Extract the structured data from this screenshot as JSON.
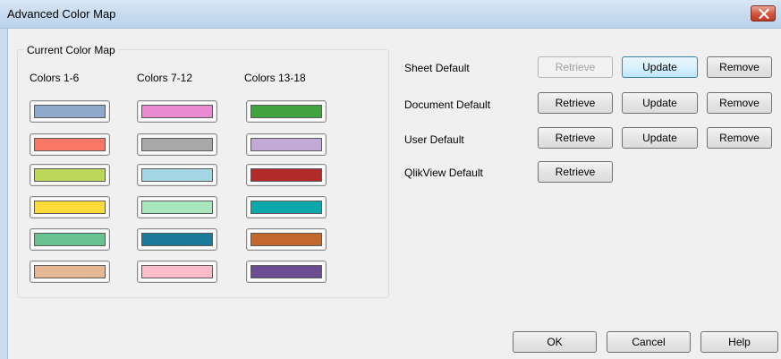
{
  "window": {
    "title": "Advanced Color Map",
    "close_icon": "close-icon"
  },
  "color_map": {
    "group_title": "Current Color Map",
    "columns": [
      {
        "header": "Colors 1-6",
        "colors": [
          "#8fa9cb",
          "#fb7766",
          "#bcd85a",
          "#ffdb3a",
          "#6ac292",
          "#e6b795"
        ]
      },
      {
        "header": "Colors 7-12",
        "colors": [
          "#ea8bd2",
          "#a8a8a8",
          "#a5d6e6",
          "#a9e5bd",
          "#1c7a98",
          "#fcbcc9"
        ]
      },
      {
        "header": "Colors 13-18",
        "colors": [
          "#41a33e",
          "#c1aad6",
          "#b22a2a",
          "#0aa8a8",
          "#c2682f",
          "#6a4e91"
        ]
      }
    ]
  },
  "defaults": {
    "rows": [
      {
        "label": "Sheet Default",
        "retrieve": "Retrieve",
        "update": "Update",
        "remove": "Remove"
      },
      {
        "label": "Document Default",
        "retrieve": "Retrieve",
        "update": "Update",
        "remove": "Remove"
      },
      {
        "label": "User Default",
        "retrieve": "Retrieve",
        "update": "Update",
        "remove": "Remove"
      },
      {
        "label": "QlikView Default",
        "retrieve": "Retrieve"
      }
    ]
  },
  "footer": {
    "ok": "OK",
    "cancel": "Cancel",
    "help": "Help"
  }
}
